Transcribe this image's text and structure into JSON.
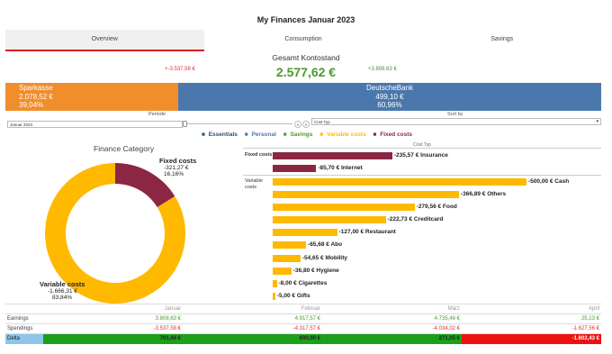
{
  "title": "My Finances Januar 2023",
  "tabs": [
    "Overview",
    "Consumption",
    "Savings"
  ],
  "kpi": {
    "label": "Gesamt Kontostand",
    "value": "2.577,62 €",
    "negative": "+-3.537,58 €",
    "positive": "+3.808,63 €"
  },
  "banks": [
    {
      "name": "Sparkasse",
      "amount": "2.078,52 €",
      "share": "39,04%"
    },
    {
      "name": "DeutscheBank",
      "amount": "499,10 €",
      "share": "60,96%"
    }
  ],
  "controls": {
    "periode_label": "Periode",
    "periode_value": "Januar 2023",
    "sort_label": "Sort by",
    "sort_value": "Cost Typ",
    "prev": "<",
    "next": ">"
  },
  "legend": [
    {
      "label": "Essentials",
      "color": "#1f4e79"
    },
    {
      "label": "Personal",
      "color": "#4a78ad"
    },
    {
      "label": "Savings",
      "color": "#4a9a2c"
    },
    {
      "label": "Variable costs",
      "color": "#ffb900"
    },
    {
      "label": "Fixed costs",
      "color": "#8b2742"
    }
  ],
  "category_title": "Finance Category",
  "donut": [
    {
      "name": "Fixed costs",
      "value": "-321,27 €",
      "pct": "16,16%",
      "share": 0.1616,
      "color": "#8b2742"
    },
    {
      "name": "Variable costs",
      "value": "-1.666,31 €",
      "pct": "83,84%",
      "share": 0.8384,
      "color": "#ffb900"
    }
  ],
  "cost_chart": {
    "header": "Cost Typ",
    "sections": [
      {
        "label": "Fixed costs",
        "color": "#8b2742",
        "items": [
          {
            "label": "-235,57 € Insurance",
            "value": 235.57
          },
          {
            "label": "-85,70 € Internet",
            "value": 85.7
          }
        ]
      },
      {
        "label": "Variable costs",
        "color": "#ffb900",
        "items": [
          {
            "label": "-500,00 € Cash",
            "value": 500.0
          },
          {
            "label": "-366,89 € Others",
            "value": 366.89
          },
          {
            "label": "-279,56 € Food",
            "value": 279.56
          },
          {
            "label": "-222,73 € Creditcard",
            "value": 222.73
          },
          {
            "label": "-127,00 € Restaurant",
            "value": 127.0
          },
          {
            "label": "-65,68 € Abo",
            "value": 65.68
          },
          {
            "label": "-54,65 € Mobility",
            "value": 54.65
          },
          {
            "label": "-36,80 € Hygiene",
            "value": 36.8
          },
          {
            "label": "-8,00 € Cigarettes",
            "value": 8.0
          },
          {
            "label": "-5,00 € Gifts",
            "value": 5.0
          }
        ]
      }
    ]
  },
  "table": {
    "months": [
      "Januar",
      "Februar",
      "März",
      "April"
    ],
    "rows": [
      {
        "label": "Earnings",
        "values": [
          "3.808,63 €",
          "4.917,57 €",
          "4.735,46 €",
          "25,13 €"
        ],
        "color": "#4a9a2c"
      },
      {
        "label": "Spendings",
        "values": [
          "-3.537,58 €",
          "-4.317,57 €",
          "-4.034,02 €",
          "-1.627,56 €"
        ],
        "color": "#e03030"
      }
    ],
    "delta": {
      "label": "Delta",
      "values": [
        "701,44 €",
        "600,00 €",
        "271,05 €",
        "-1.602,43 €"
      ],
      "colors": [
        "#1aa01a",
        "#1aa01a",
        "#1aa01a",
        "#ee1111"
      ]
    }
  }
}
